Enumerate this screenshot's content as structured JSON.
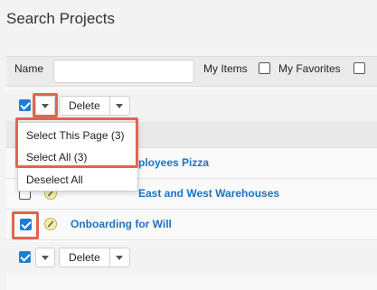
{
  "page": {
    "title": "Search Projects"
  },
  "search": {
    "name_label": "Name",
    "name_value": "",
    "my_items_label": "My Items",
    "my_favorites_label": "My Favorites"
  },
  "top_actions": {
    "delete_label": "Delete"
  },
  "bottom_actions": {
    "delete_label": "Delete"
  },
  "select_menu": {
    "items": [
      {
        "label": "Select This Page (3)"
      },
      {
        "label": "Select All (3)"
      },
      {
        "label": "Deselect All"
      }
    ]
  },
  "records": [
    {
      "name": "Employees Pizza",
      "visible_text": "ployees Pizza",
      "checked": false
    },
    {
      "name": "Consolidate East and West Warehouses",
      "visible_text": "East and West Warehouses",
      "checked": false
    },
    {
      "name": "Onboarding for Will",
      "visible_text": "Onboarding for Will",
      "checked": true
    }
  ],
  "colors": {
    "accent": "#1e7cd4",
    "link": "#1a73c4",
    "highlight": "#e06550"
  }
}
